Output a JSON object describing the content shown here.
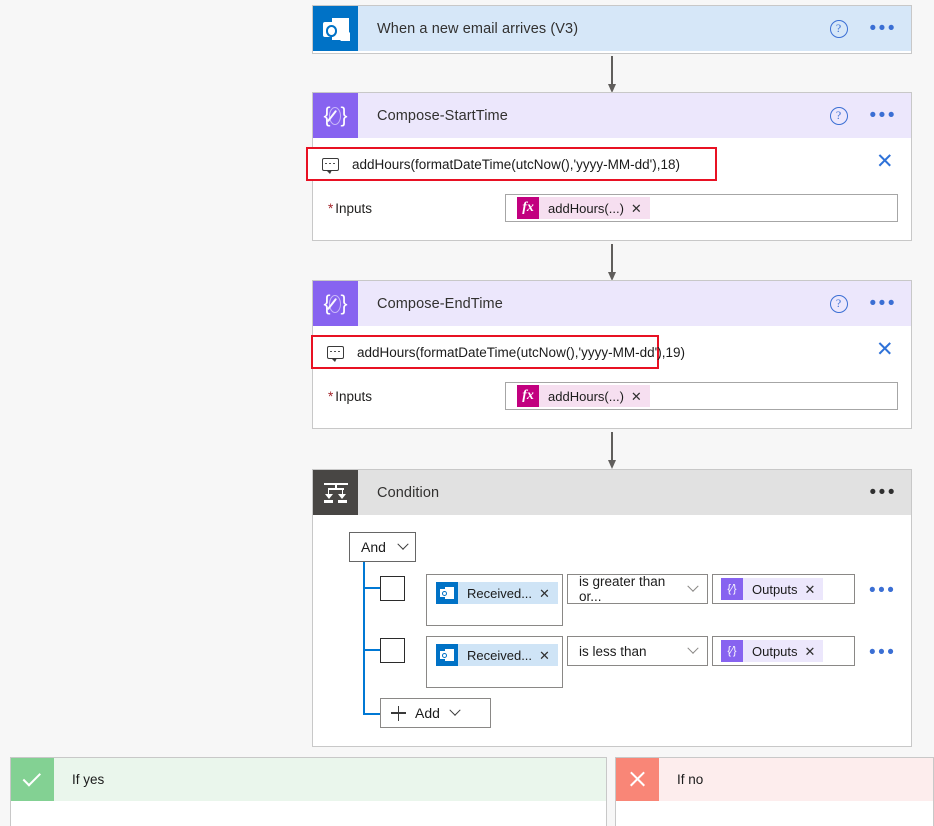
{
  "flow": {
    "trigger": {
      "title": "When a new email arrives (V3)",
      "icon": "outlook-icon",
      "help_label": "?",
      "menu_label": "•••"
    },
    "actions": [
      {
        "id": "compose-starttime",
        "title": "Compose-StartTime",
        "icon": "compose-icon",
        "help_label": "?",
        "menu_label": "•••",
        "tooltip": {
          "icon": "intellisense-tooltip-icon",
          "text": "addHours(formatDateTime(utcNow(),'yyyy-MM-dd'),18)",
          "close_label": "✕"
        },
        "field": {
          "required_marker": "*",
          "label": "Inputs",
          "token": {
            "badge": "fx",
            "label": "addHours(...)",
            "remove_label": "✕"
          }
        }
      },
      {
        "id": "compose-endtime",
        "title": "Compose-EndTime",
        "icon": "compose-icon",
        "help_label": "?",
        "menu_label": "•••",
        "tooltip": {
          "icon": "intellisense-tooltip-icon",
          "text": "addHours(formatDateTime(utcNow(),'yyyy-MM-dd'),19)",
          "close_label": "✕"
        },
        "field": {
          "required_marker": "*",
          "label": "Inputs",
          "token": {
            "badge": "fx",
            "label": "addHours(...)",
            "remove_label": "✕"
          }
        }
      }
    ],
    "condition": {
      "title": "Condition",
      "icon": "condition-icon",
      "menu_label": "•••",
      "logical_operator": "And",
      "rows": [
        {
          "operand": {
            "badge": "outlook-icon",
            "label": "Received...",
            "remove_label": "✕"
          },
          "operator": "is greater than or...",
          "value": {
            "badge": "compose-icon",
            "label": "Outputs",
            "remove_label": "✕"
          },
          "row_menu_label": "•••"
        },
        {
          "operand": {
            "badge": "outlook-icon",
            "label": "Received...",
            "remove_label": "✕"
          },
          "operator": "is less than",
          "value": {
            "badge": "compose-icon",
            "label": "Outputs",
            "remove_label": "✕"
          },
          "row_menu_label": "•••"
        }
      ],
      "add_button": "Add"
    },
    "branches": {
      "yes": {
        "label": "If yes",
        "icon": "check-icon"
      },
      "no": {
        "label": "If no",
        "icon": "close-icon"
      }
    }
  },
  "colors": {
    "outlook_blue": "#0072c6",
    "compose_purple": "#8763f0",
    "condition_gray": "#484644",
    "highlight_red": "#e81123",
    "token_fx_magenta": "#c2007f",
    "tree_blue": "#0078d4",
    "yes_green": "#83d193",
    "no_red": "#f98677",
    "page_background": "#f7f7f7"
  }
}
